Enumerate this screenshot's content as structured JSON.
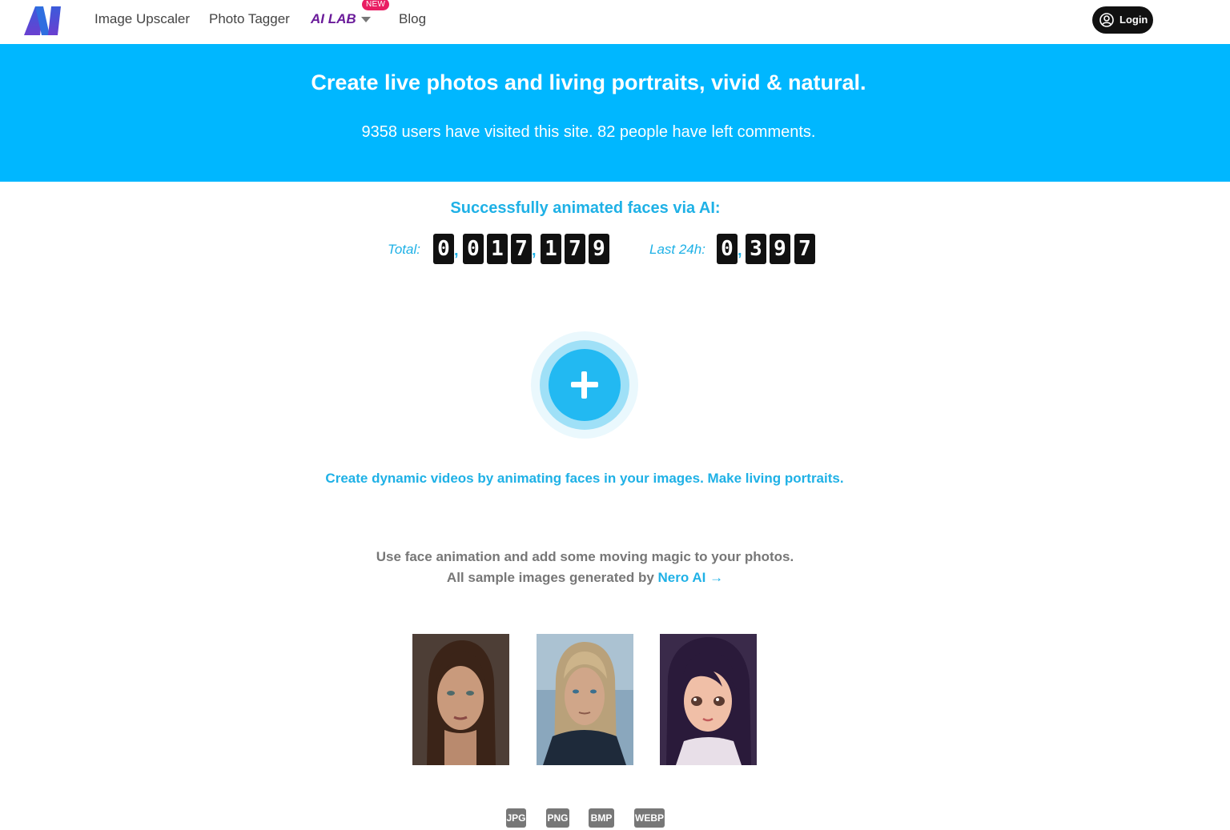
{
  "nav": {
    "logo_text": "AI",
    "links": [
      "Image Upscaler",
      "Photo Tagger",
      "AI LAB",
      "Blog"
    ],
    "new_badge": "NEW",
    "login_label": "Login"
  },
  "hero": {
    "title": "Create live photos and living portraits, vivid & natural.",
    "subtitle": "9358 users have visited this site. 82 people have left comments."
  },
  "stats": {
    "title": "Successfully animated faces via AI:",
    "total_label": "Total:",
    "total_digits": [
      "0",
      "0",
      "1",
      "7",
      "1",
      "7",
      "9"
    ],
    "last24_label": "Last 24h:",
    "last24_digits": [
      "0",
      "3",
      "9",
      "7"
    ],
    "separator": ","
  },
  "upload": {
    "cta": "Create dynamic videos by animating faces in your images. Make living portraits."
  },
  "description": {
    "line1": "Use face animation and add some moving magic to your photos.",
    "line2_prefix": "All sample images generated by ",
    "line2_link": "Nero AI →"
  },
  "samples": [
    {
      "subject": "woman-portrait"
    },
    {
      "subject": "man-portrait"
    },
    {
      "subject": "anime-girl-portrait"
    }
  ],
  "formats": [
    "JPG",
    "PNG",
    "BMP",
    "WEBP"
  ],
  "colors": {
    "hero_bg": "#00b7ff",
    "accent": "#1fb1e6",
    "ai_lab": "#6a1b9a",
    "new_badge": "#e91e63"
  }
}
